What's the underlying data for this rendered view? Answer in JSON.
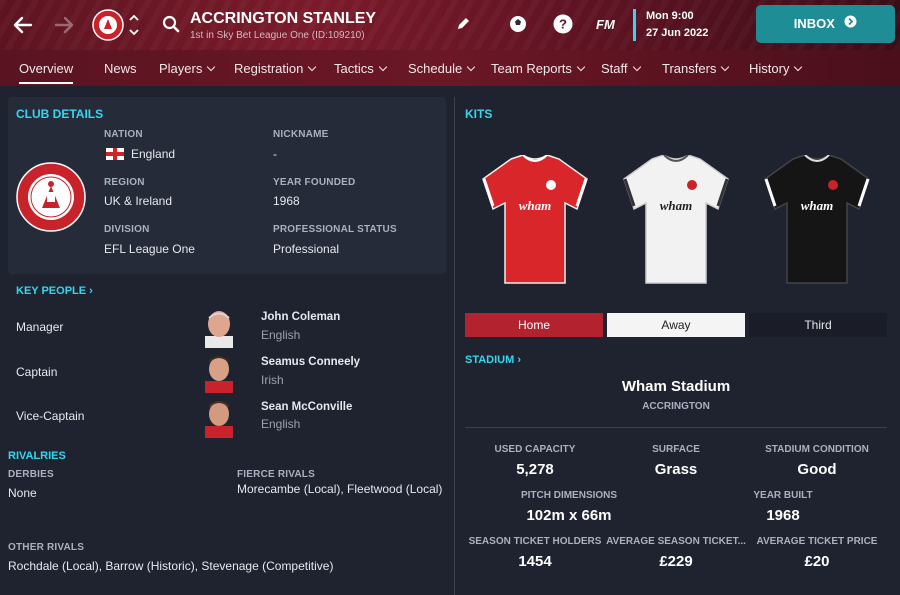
{
  "header": {
    "club_name": "ACCRINGTON STANLEY",
    "subtitle": "1st in Sky Bet League One (ID:109210)",
    "time": "Mon 9:00",
    "date": "27 Jun 2022",
    "fm_label": "FM",
    "inbox_label": "INBOX"
  },
  "nav": {
    "tabs": [
      "Overview",
      "News",
      "Players",
      "Registration",
      "Tactics",
      "Schedule",
      "Team Reports",
      "Staff",
      "Transfers",
      "History"
    ]
  },
  "club_details": {
    "heading": "CLUB DETAILS",
    "nation_label": "NATION",
    "nation": "England",
    "nickname_label": "NICKNAME",
    "nickname": "-",
    "region_label": "REGION",
    "region": "UK & Ireland",
    "year_founded_label": "YEAR FOUNDED",
    "year_founded": "1968",
    "division_label": "DIVISION",
    "division": "EFL League One",
    "pro_status_label": "PROFESSIONAL STATUS",
    "pro_status": "Professional"
  },
  "key_people": {
    "heading": "KEY PEOPLE",
    "people": [
      {
        "role": "Manager",
        "name": "John Coleman",
        "nationality": "English"
      },
      {
        "role": "Captain",
        "name": "Seamus Conneely",
        "nationality": "Irish"
      },
      {
        "role": "Vice-Captain",
        "name": "Sean McConville",
        "nationality": "English"
      }
    ]
  },
  "rivalries": {
    "heading": "RIVALRIES",
    "derbies_label": "DERBIES",
    "derbies": "None",
    "fierce_label": "FIERCE RIVALS",
    "fierce": "Morecambe (Local), Fleetwood (Local)",
    "other_label": "OTHER RIVALS",
    "other": "Rochdale (Local), Barrow (Historic), Stevenage (Competitive)"
  },
  "kits": {
    "heading": "KITS",
    "sponsor": "wham",
    "tabs": [
      "Home",
      "Away",
      "Third"
    ],
    "colors": {
      "home": "#d8262a",
      "away": "#f2f2f2",
      "third": "#151515"
    }
  },
  "stadium": {
    "heading": "STADIUM",
    "name": "Wham Stadium",
    "city": "ACCRINGTON",
    "used_capacity_label": "USED CAPACITY",
    "used_capacity": "5,278",
    "surface_label": "SURFACE",
    "surface": "Grass",
    "condition_label": "STADIUM CONDITION",
    "condition": "Good",
    "pitch_label": "PITCH DIMENSIONS",
    "pitch": "102m x 66m",
    "year_built_label": "YEAR BUILT",
    "year_built": "1968",
    "st_holders_label": "SEASON TICKET HOLDERS",
    "st_holders": "1454",
    "avg_st_label": "AVERAGE SEASON TICKET...",
    "avg_st": "£229",
    "avg_ticket_label": "AVERAGE TICKET PRICE",
    "avg_ticket": "£20"
  },
  "colors": {
    "accent": "#35d6f0",
    "brand": "#7a1a2a",
    "inbox": "#1e8d95"
  }
}
